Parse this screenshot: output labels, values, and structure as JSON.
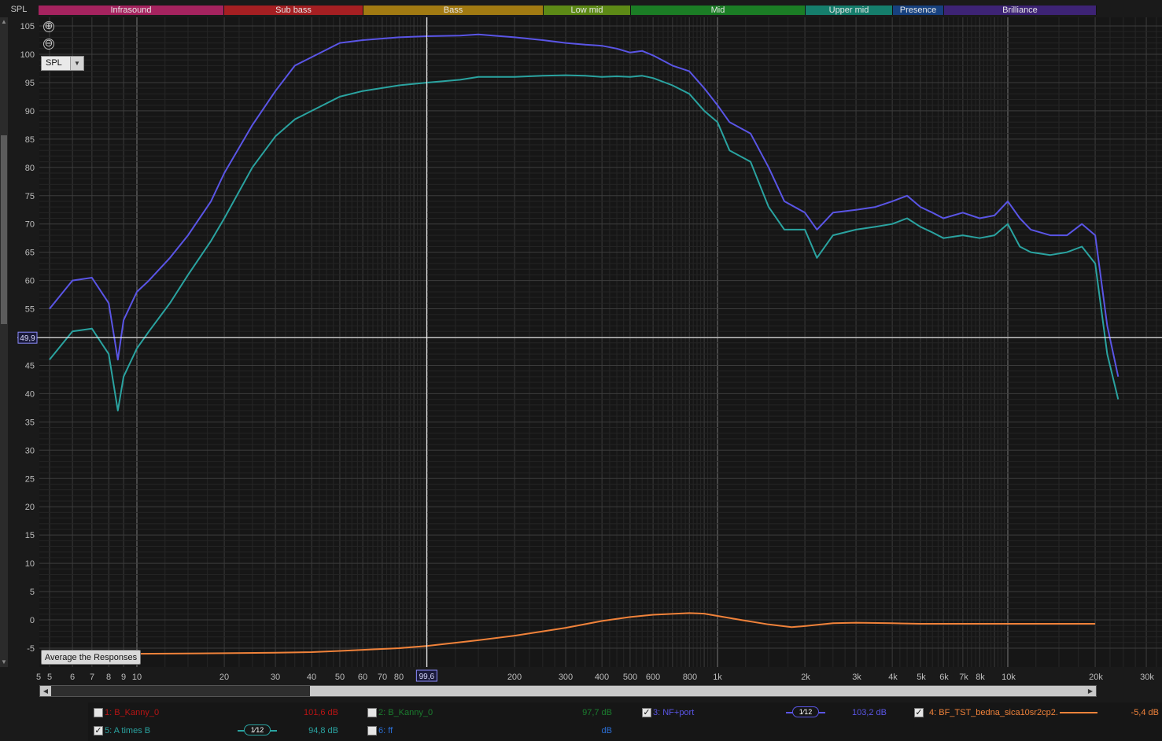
{
  "app": {
    "spl_tag": "SPL"
  },
  "bands": [
    {
      "label": "Infrasound",
      "color": "#a5235f"
    },
    {
      "label": "Sub bass",
      "color": "#a51f22"
    },
    {
      "label": "Bass",
      "color": "#a17a12"
    },
    {
      "label": "Low mid",
      "color": "#5d8a16"
    },
    {
      "label": "Mid",
      "color": "#1b7d25"
    },
    {
      "label": "Upper mid",
      "color": "#157e6c"
    },
    {
      "label": "Presence",
      "color": "#17417f"
    },
    {
      "label": "Brilliance",
      "color": "#3d2375"
    }
  ],
  "controls": {
    "zoom_in_icon": "⊕",
    "zoom_out_icon": "⊖",
    "y_select_value": "SPL",
    "average_button": "Average the Responses"
  },
  "cursor": {
    "x_readout": "99,6",
    "y_readout": "49,9",
    "x": 99.6,
    "y": 49.9
  },
  "legend": {
    "items": [
      {
        "id": "1",
        "checked": false,
        "label": "1: B_Kanny_0",
        "value": "101,6 dB",
        "color": "#b81414",
        "smoothing": ""
      },
      {
        "id": "2",
        "checked": false,
        "label": "2: B_Kanny_0",
        "value": "97,7 dB",
        "color": "#1b7d2e",
        "smoothing": ""
      },
      {
        "id": "3",
        "checked": true,
        "label": "3: NF+port",
        "value": "103,2 dB",
        "color": "#5a55e6",
        "smoothing": "1⁄12"
      },
      {
        "id": "4",
        "checked": true,
        "label": "4: BF_TST_bedna_sica10sr2cp2.",
        "value": "-5,4 dB",
        "color": "#f0823a",
        "smoothing": ""
      },
      {
        "id": "5",
        "checked": true,
        "label": "5: A times B",
        "value": "94,8 dB",
        "color": "#2aa3a0",
        "smoothing": "1⁄12"
      },
      {
        "id": "6",
        "checked": false,
        "label": "6: ff",
        "value": "dB",
        "color": "#2b6fd6",
        "smoothing": ""
      }
    ]
  },
  "chart_data": {
    "type": "line",
    "title": "",
    "xlabel": "",
    "ylabel": "SPL",
    "x_scale": "log",
    "xlim": [
      5,
      30000
    ],
    "ylim": [
      -8,
      107
    ],
    "grid": true,
    "x_tick_labels": [
      "5",
      "5",
      "6",
      "7",
      "8",
      "9",
      "10",
      "20",
      "30",
      "40",
      "50",
      "60",
      "70",
      "80",
      "200",
      "300",
      "400",
      "500",
      "600",
      "800",
      "1k",
      "2k",
      "3k",
      "4k",
      "5k",
      "6k",
      "7k",
      "8k",
      "10k",
      "20k",
      "30k"
    ],
    "y_tick_labels": [
      "105",
      "100",
      "95",
      "90",
      "85",
      "80",
      "75",
      "70",
      "65",
      "60",
      "55",
      "45",
      "40",
      "35",
      "30",
      "25",
      "20",
      "15",
      "10",
      "5",
      "0",
      "-5"
    ],
    "series": [
      {
        "name": "3: NF+port",
        "color": "#5a55e6",
        "x": [
          5,
          6,
          7,
          8,
          8.6,
          9,
          10,
          11,
          13,
          15,
          18,
          20,
          25,
          30,
          35,
          40,
          50,
          60,
          80,
          100,
          130,
          150,
          200,
          250,
          300,
          350,
          400,
          450,
          500,
          550,
          600,
          700,
          800,
          900,
          1000,
          1100,
          1300,
          1500,
          1700,
          2000,
          2200,
          2500,
          3000,
          3500,
          4000,
          4500,
          5000,
          5500,
          6000,
          7000,
          8000,
          9000,
          10000,
          11000,
          12000,
          14000,
          16000,
          18000,
          20000,
          22000,
          24000
        ],
        "y": [
          55,
          60,
          60.5,
          56,
          46,
          53,
          58,
          60,
          64,
          68,
          74,
          79,
          87.5,
          93.5,
          98,
          99.5,
          102,
          102.5,
          103,
          103.2,
          103.3,
          103.5,
          103,
          102.5,
          102,
          101.7,
          101.5,
          101,
          100.3,
          100.6,
          99.8,
          98,
          97,
          94,
          91,
          88,
          86,
          80,
          74,
          72,
          69,
          72,
          72.5,
          73,
          74,
          75,
          73,
          72,
          71,
          72,
          71,
          71.5,
          74,
          71,
          69,
          68,
          68,
          70,
          68,
          52,
          43
        ]
      },
      {
        "name": "5: A times B",
        "color": "#2aa3a0",
        "x": [
          5,
          6,
          7,
          8,
          8.6,
          9,
          10,
          11,
          13,
          15,
          18,
          20,
          25,
          30,
          35,
          40,
          50,
          60,
          80,
          100,
          130,
          150,
          200,
          250,
          300,
          350,
          400,
          450,
          500,
          550,
          600,
          700,
          800,
          900,
          1000,
          1100,
          1300,
          1500,
          1700,
          2000,
          2200,
          2500,
          3000,
          3500,
          4000,
          4500,
          5000,
          5500,
          6000,
          7000,
          8000,
          9000,
          10000,
          11000,
          12000,
          14000,
          16000,
          18000,
          20000,
          22000,
          24000
        ],
        "y": [
          46,
          51,
          51.5,
          47,
          37,
          43,
          48,
          51,
          56,
          61,
          67,
          71,
          80,
          85.5,
          88.5,
          90,
          92.5,
          93.5,
          94.5,
          95,
          95.5,
          96,
          96,
          96.2,
          96.3,
          96.2,
          96,
          96.1,
          96,
          96.2,
          95.8,
          94.5,
          93,
          90,
          88,
          83,
          81,
          73,
          69,
          69,
          64,
          68,
          69,
          69.5,
          70,
          71,
          69.5,
          68.5,
          67.5,
          68,
          67.5,
          68,
          70,
          66,
          65,
          64.5,
          65,
          66,
          63,
          47,
          39
        ]
      },
      {
        "name": "4: BF_TST_bedna_sica10sr2cp2.",
        "color": "#f0823a",
        "x": [
          10,
          20,
          30,
          40,
          50,
          60,
          80,
          100,
          150,
          200,
          300,
          400,
          500,
          600,
          800,
          900,
          1000,
          1200,
          1500,
          1800,
          2000,
          2500,
          3000,
          4000,
          5000,
          8000,
          10000,
          20000
        ],
        "y": [
          -6,
          -5.9,
          -5.8,
          -5.7,
          -5.5,
          -5.3,
          -5.0,
          -4.6,
          -3.6,
          -2.8,
          -1.4,
          -0.2,
          0.5,
          0.9,
          1.2,
          1.1,
          0.7,
          0.0,
          -0.8,
          -1.3,
          -1.1,
          -0.6,
          -0.5,
          -0.6,
          -0.7,
          -0.7,
          -0.7,
          -0.7
        ]
      }
    ]
  }
}
